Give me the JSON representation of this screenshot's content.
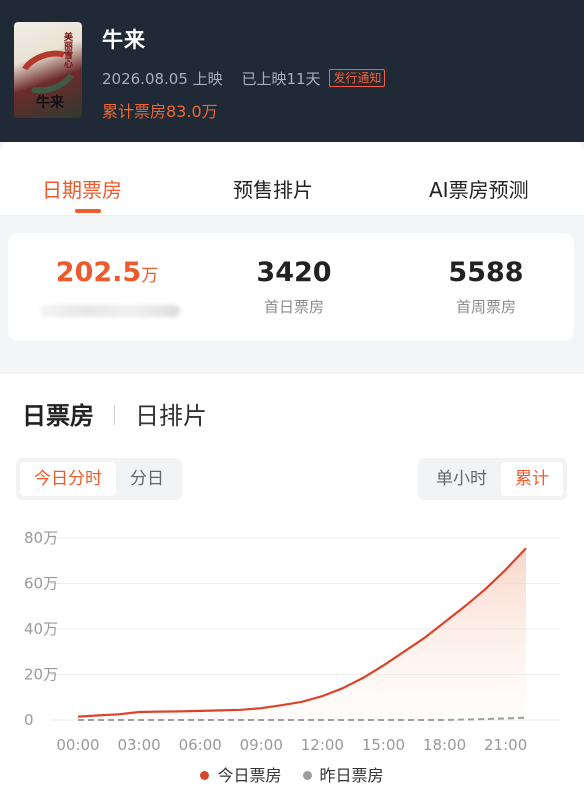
{
  "movie": {
    "title": "牛来",
    "poster_text": "美丽雪心",
    "poster_title": "牛来",
    "release_date": "2026.08.05 上映",
    "days_released": "已上映11天",
    "notice_badge": "发行通知",
    "cumulative": "累计票房83.0万"
  },
  "tabs": [
    {
      "label": "日期票房",
      "active": true
    },
    {
      "label": "预售排片",
      "active": false
    },
    {
      "label": "AI票房预测",
      "active": false
    }
  ],
  "stats": [
    {
      "value": "202.5",
      "unit": "万",
      "caption": ""
    },
    {
      "value": "3420",
      "unit": "",
      "caption": "首日票房"
    },
    {
      "value": "5588",
      "unit": "",
      "caption": "首周票房"
    }
  ],
  "section": {
    "tab_box_office": "日票房",
    "tab_schedule": "日排片"
  },
  "controls": {
    "left": [
      "今日分时",
      "分日"
    ],
    "right": [
      "单小时",
      "累计"
    ],
    "left_selected": "今日分时",
    "right_selected": "累计"
  },
  "colors": {
    "accent": "#ef5a2c",
    "today_line": "#d9442a",
    "yesterday_line": "#9e9e9e"
  },
  "chart_data": {
    "type": "area",
    "x": [
      "00:00",
      "01:00",
      "02:00",
      "03:00",
      "04:00",
      "05:00",
      "06:00",
      "07:00",
      "08:00",
      "09:00",
      "10:00",
      "11:00",
      "12:00",
      "13:00",
      "14:00",
      "15:00",
      "16:00",
      "17:00",
      "18:00",
      "19:00",
      "20:00",
      "21:00",
      "22:00"
    ],
    "x_ticks": [
      "00:00",
      "03:00",
      "06:00",
      "09:00",
      "12:00",
      "15:00",
      "18:00",
      "21:00"
    ],
    "y_ticks": [
      "80万",
      "60万",
      "40万",
      "20万",
      "0"
    ],
    "ylim": [
      0,
      80
    ],
    "unit": "万",
    "series": [
      {
        "name": "今日票房",
        "color": "#d9442a",
        "values": [
          1.5,
          2.0,
          2.5,
          3.5,
          3.7,
          3.8,
          4.0,
          4.2,
          4.5,
          5.2,
          6.5,
          8.0,
          10.5,
          14.0,
          18.5,
          24.0,
          30.0,
          36.0,
          43.0,
          50.0,
          57.5,
          66.0,
          75.5
        ]
      },
      {
        "name": "昨日票房",
        "color": "#9e9e9e",
        "values": [
          0,
          0,
          0,
          0,
          0,
          0,
          0,
          0,
          0,
          0,
          0,
          0,
          0,
          0,
          0,
          0,
          0,
          0,
          0,
          0.2,
          0.4,
          0.7,
          1.0
        ]
      }
    ],
    "legend_position": "bottom",
    "grid": true
  }
}
